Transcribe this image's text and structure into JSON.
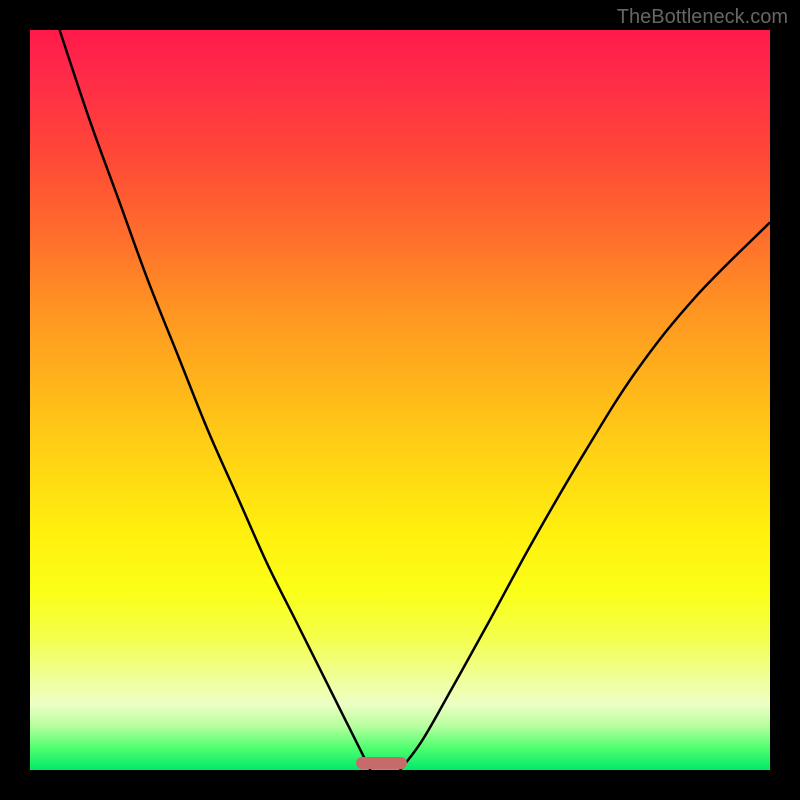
{
  "watermark": "TheBottleneck.com",
  "chart_data": {
    "type": "line",
    "title": "",
    "xlabel": "",
    "ylabel": "",
    "xlim": [
      0,
      100
    ],
    "ylim": [
      0,
      100
    ],
    "series": [
      {
        "name": "left-curve",
        "x": [
          4,
          8,
          12,
          16,
          20,
          24,
          28,
          32,
          36,
          40,
          43,
          45,
          46
        ],
        "y": [
          100,
          88,
          77,
          66,
          56,
          46,
          37,
          28,
          20,
          12,
          6,
          2,
          0
        ]
      },
      {
        "name": "right-curve",
        "x": [
          50,
          53,
          57,
          62,
          68,
          75,
          82,
          90,
          100
        ],
        "y": [
          0,
          4,
          11,
          20,
          31,
          43,
          54,
          64,
          74
        ]
      }
    ],
    "marker": {
      "x_start": 44,
      "x_end": 51,
      "y": 1,
      "color": "#c76a6a"
    },
    "background_gradient": {
      "top": "#ff1a4a",
      "mid": "#fff00e",
      "bottom": "#00e96a"
    }
  }
}
